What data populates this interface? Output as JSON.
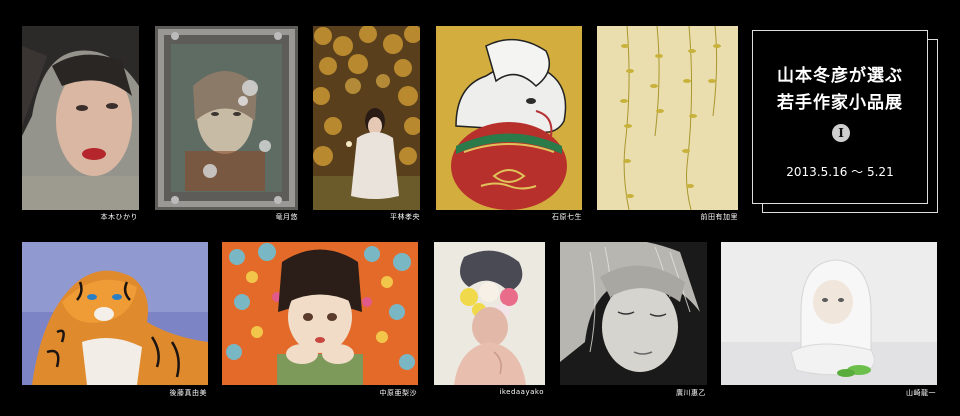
{
  "exhibition": {
    "title_line1": "山本冬彦が選ぶ",
    "title_line2": "若手作家小品展",
    "volume": "Ⅰ",
    "dates": "2013.5.16 ～ 5.21"
  },
  "artworks_row1": [
    {
      "artist": "本木ひかり",
      "subject": "portrait-girl-red-lips"
    },
    {
      "artist": "竜月悠",
      "subject": "portrait-woman-metal-frame"
    },
    {
      "artist": "平林孝央",
      "subject": "kneeling-girl-autumn-leaves"
    },
    {
      "artist": "石原七生",
      "subject": "white-elephant-ganesha"
    },
    {
      "artist": "前田有加里",
      "subject": "willow-branches"
    }
  ],
  "artworks_row2": [
    {
      "artist": "後藤真由美",
      "subject": "tiger"
    },
    {
      "artist": "中原亜梨沙",
      "subject": "girl-with-flowers"
    },
    {
      "artist": "ikedaayako",
      "subject": "boy-flower-crown"
    },
    {
      "artist": "廣川惠乙",
      "subject": "woman-closed-eyes"
    },
    {
      "artist": "山崎龍一",
      "subject": "white-hooded-figure-sculpture"
    }
  ],
  "colors": {
    "background": "#000000",
    "text": "#ffffff",
    "frame": "#dddddd",
    "badge": "#cfcfcf"
  }
}
